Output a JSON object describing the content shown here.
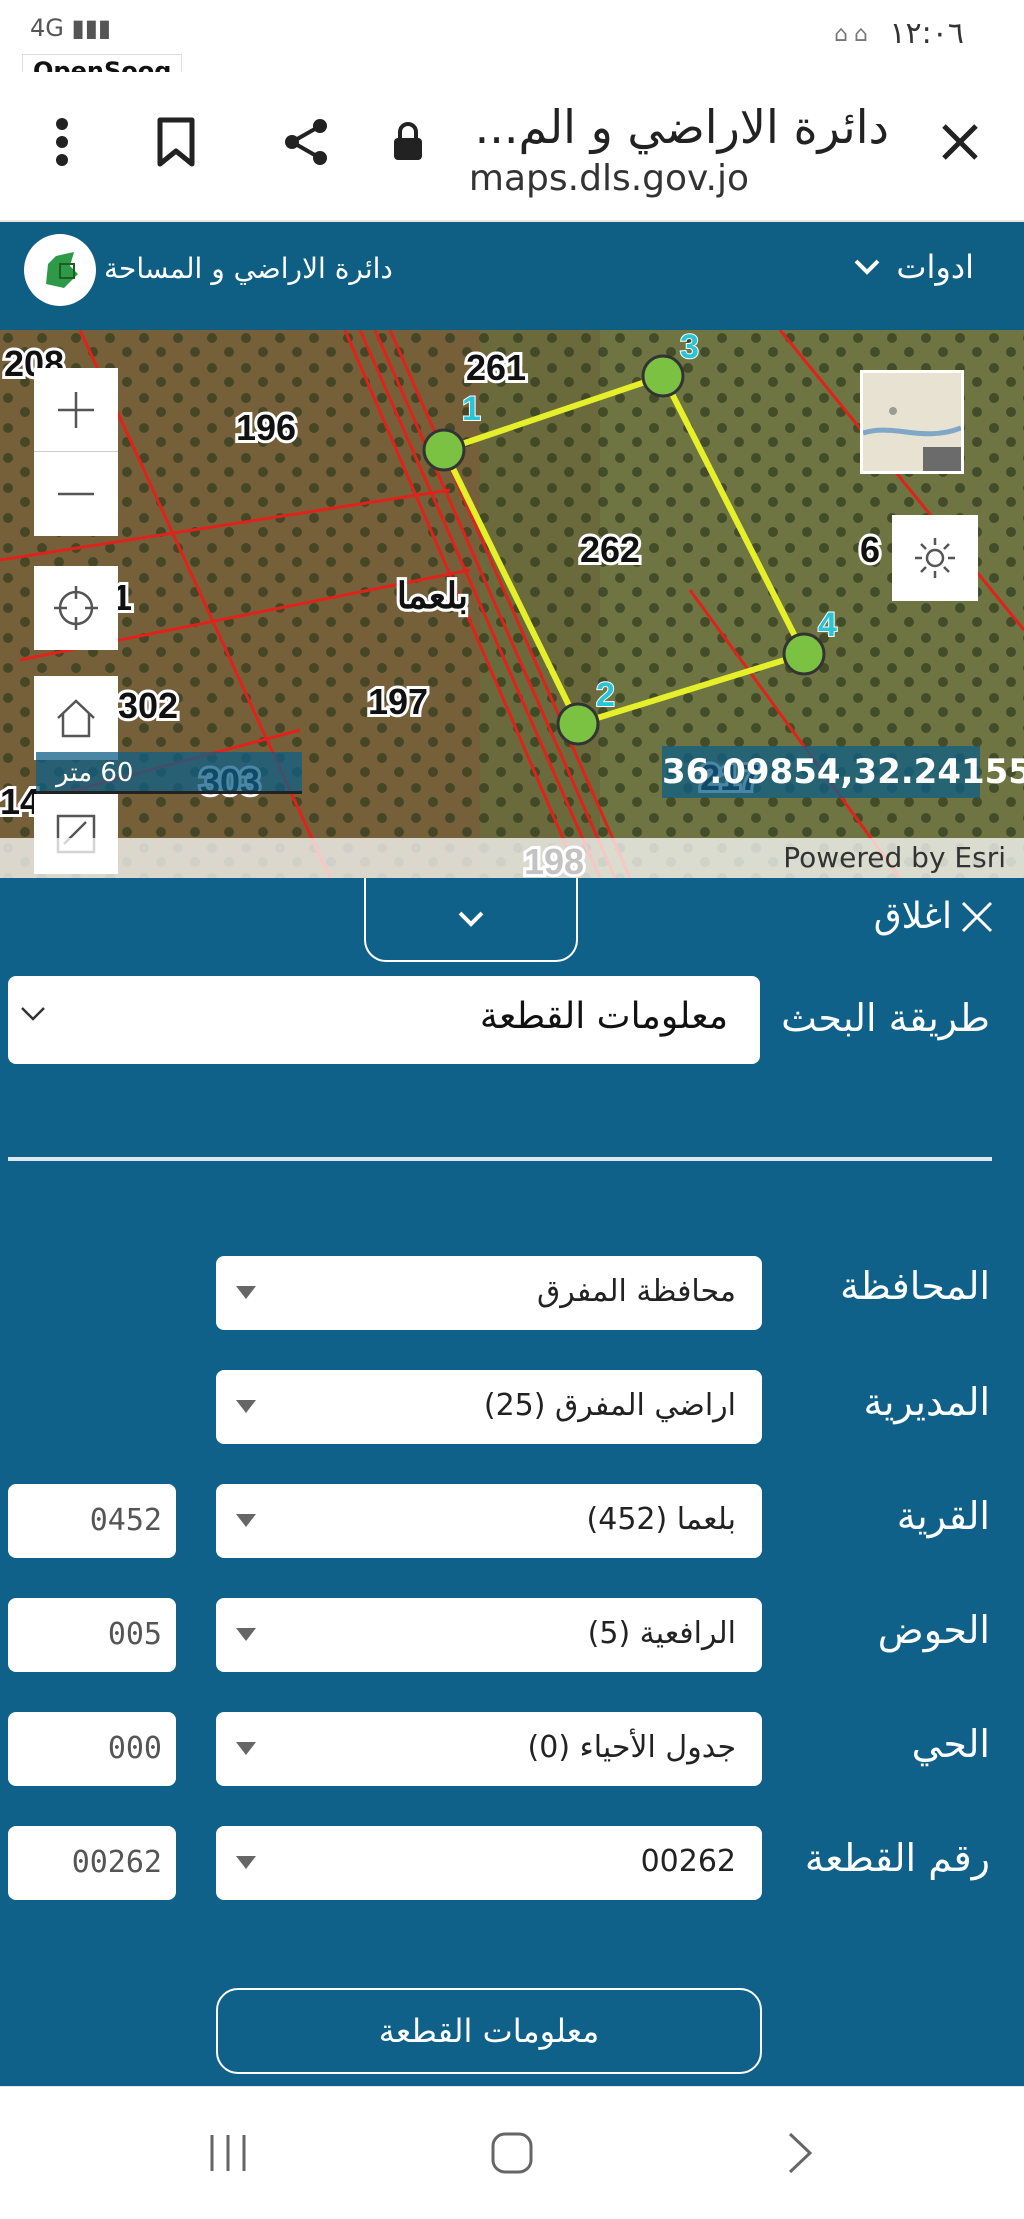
{
  "status_bar": {
    "time": "١٢:٠٦",
    "network": "4G",
    "watermark": "OpenSooq"
  },
  "browser": {
    "title": "دائرة الاراضي و الم...",
    "url": "maps.dls.gov.jo",
    "icons": [
      "close-icon",
      "lock-icon",
      "share-icon",
      "bookmark-icon",
      "more-icon"
    ]
  },
  "app_header": {
    "title": "دائرة الاراضي و المساحة",
    "tools_label": "ادوات"
  },
  "map": {
    "parcel_labels": {
      "p261": "261",
      "p196": "196",
      "p262": "262",
      "p197": "197",
      "p302": "302",
      "p303": "303",
      "p198": "198",
      "p208": "208",
      "p217": "217",
      "p6": "6",
      "p1": "1",
      "p14": "14"
    },
    "village_label": "بلعما",
    "vertex_labels": [
      "1",
      "2",
      "3",
      "4"
    ],
    "coordinates": "36.09854,32.24155",
    "scale": "60 متر",
    "attribution": "Powered by Esri",
    "colors": {
      "highlight": "#e6f02a",
      "vertex": "#7bc142",
      "vertex_label": "#29c5d6",
      "parcel_lines": "#e0221b"
    }
  },
  "panel": {
    "close_label": "اغلاق",
    "search_method": {
      "label": "طريقة البحث",
      "value": "معلومات القطعة"
    },
    "fields": {
      "governorate": {
        "label": "المحافظة",
        "value": "محافظة المفرق"
      },
      "directorate": {
        "label": "المديرية",
        "value": "اراضي المفرق (25)"
      },
      "village": {
        "label": "القرية",
        "value": "بلعما (452)",
        "code": "0452"
      },
      "basin": {
        "label": "الحوض",
        "value": "الرافعية (5)",
        "code": "005"
      },
      "neighborhood": {
        "label": "الحي",
        "value": "جدول الأحياء (0)",
        "code": "000"
      },
      "parcel": {
        "label": "رقم القطعة",
        "value": "00262",
        "code": "00262"
      }
    },
    "submit_label": "معلومات القطعة",
    "colors": {
      "background": "#0f6189"
    }
  }
}
